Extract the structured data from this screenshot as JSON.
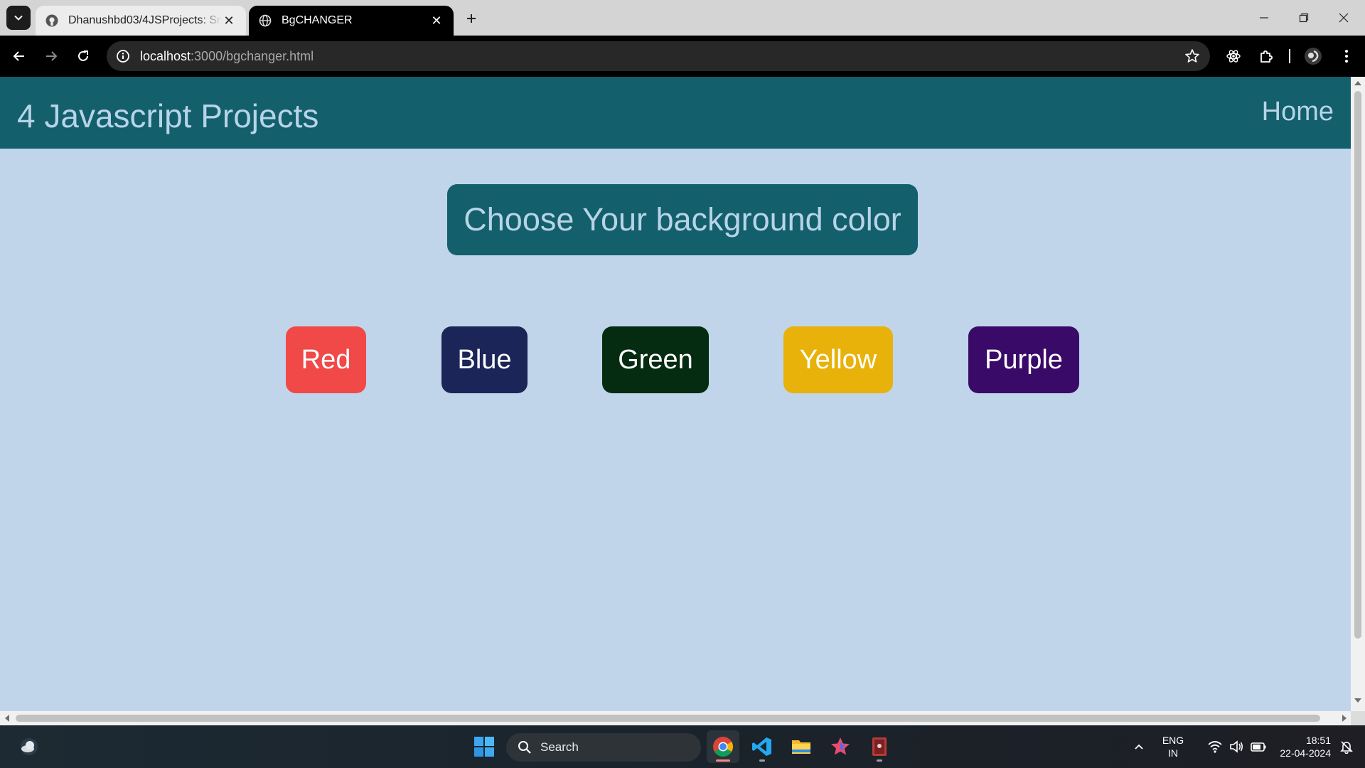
{
  "browser": {
    "tabs": [
      {
        "title": "Dhanushbd03/4JSProjects: Sm",
        "active": false,
        "favicon": "github-icon"
      },
      {
        "title": "BgCHANGER",
        "active": true,
        "favicon": "globe-icon"
      }
    ],
    "address": {
      "host": "localhost",
      "path": ":3000/bgchanger.html"
    }
  },
  "page": {
    "brand": "4 Javascript Projects",
    "nav_home": "Home",
    "heading": "Choose Your background color",
    "buttons": [
      {
        "label": "Red",
        "color": "#f14848"
      },
      {
        "label": "Blue",
        "color": "#1b2558"
      },
      {
        "label": "Green",
        "color": "#052b11"
      },
      {
        "label": "Yellow",
        "color": "#e8b20b"
      },
      {
        "label": "Purple",
        "color": "#3a0a68"
      }
    ],
    "background_color": "#c0d5e9",
    "accent_color": "#135f6b"
  },
  "taskbar": {
    "search_placeholder": "Search",
    "apps": [
      "chrome-icon",
      "vscode-icon",
      "file-explorer-icon",
      "paint-icon",
      "terminal-icon"
    ],
    "tray": {
      "language": "ENG",
      "region": "IN",
      "time": "18:51",
      "date": "22-04-2024"
    }
  }
}
